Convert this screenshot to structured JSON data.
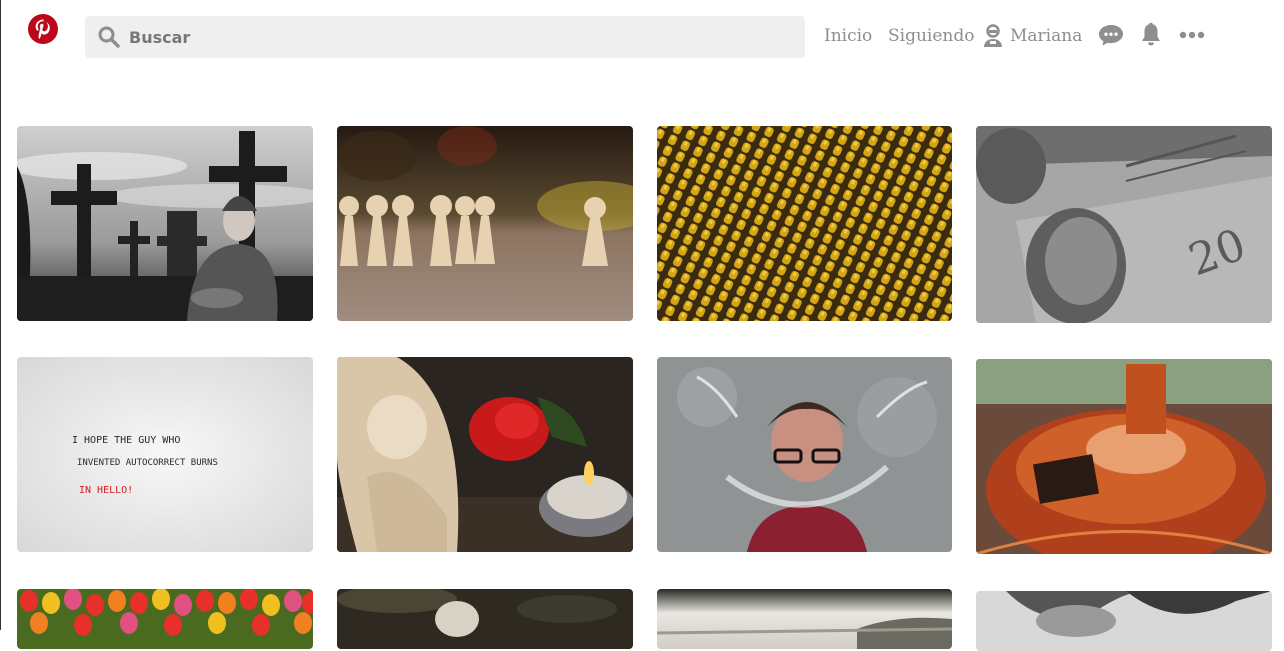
{
  "header": {
    "logo_icon": "pinterest-logo",
    "brand_color": "#bd081c",
    "search": {
      "placeholder": "Buscar",
      "value": ""
    },
    "nav": {
      "home": "Inicio",
      "following": "Siguiendo"
    },
    "user": {
      "name": "Mariana",
      "icon": "user-icon"
    },
    "icons": [
      "chat-bubble-icon",
      "bell-icon",
      "more-dots-icon"
    ]
  },
  "pins": [
    {
      "subject": "cemetery-old-man-bw"
    },
    {
      "subject": "wooden-peg-figures"
    },
    {
      "subject": "yellow-figurines-rows"
    },
    {
      "subject": "banknote-bw"
    },
    {
      "subject": "handwritten-note",
      "note_lines": [
        "I HOPE THE GUY WHO",
        "INVENTED AUTOCORRECT BURNS",
        "IN HELLO!"
      ]
    },
    {
      "subject": "angel-rose-candle"
    },
    {
      "subject": "woman-water-splash"
    },
    {
      "subject": "copper-kettle"
    },
    {
      "subject": "tulips"
    },
    {
      "subject": "hands-dark"
    },
    {
      "subject": "misty-landscape"
    },
    {
      "subject": "hands-bw"
    }
  ]
}
